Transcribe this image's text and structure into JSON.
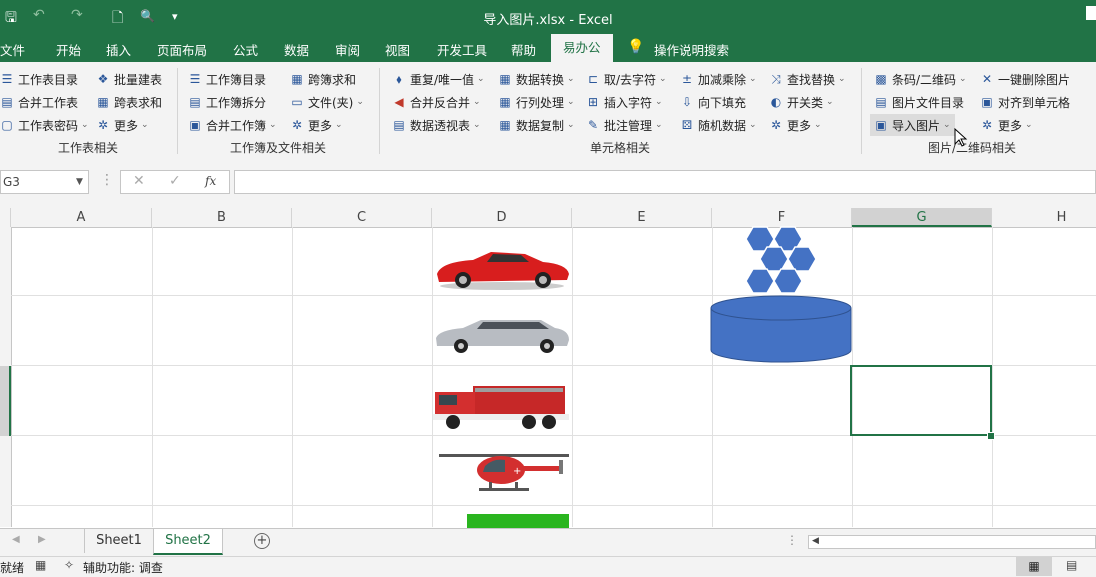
{
  "window": {
    "title": "导入图片.xlsx  -  Excel"
  },
  "quick_access": {
    "save": "🖫",
    "undo": "↶",
    "redo": "↷",
    "new": "🗋",
    "preview": "🔍",
    "more": "▾"
  },
  "menu": {
    "tabs": [
      "文件",
      "开始",
      "插入",
      "页面布局",
      "公式",
      "数据",
      "审阅",
      "视图",
      "开发工具",
      "帮助",
      "易办公"
    ],
    "active": "易办公",
    "search_label": "操作说明搜索"
  },
  "ribbon": {
    "g1": {
      "items": [
        "工作表目录",
        "合并工作表",
        "工作表密码",
        "批量建表",
        "跨表求和",
        "更多"
      ],
      "label": "工作表相关"
    },
    "g2": {
      "items": [
        "工作簿目录",
        "工作簿拆分",
        "合并工作簿",
        "跨簿求和",
        "文件(夹)",
        "更多"
      ],
      "label": "工作簿及文件相关"
    },
    "g3": {
      "items": [
        "重复/唯一值",
        "合并反合并",
        "数据透视表",
        "数据转换",
        "行列处理",
        "数据复制",
        "取/去字符",
        "插入字符",
        "批注管理",
        "加减乘除",
        "向下填充",
        "随机数据",
        "查找替换",
        "开关类",
        "更多"
      ],
      "label": "单元格相关"
    },
    "g4": {
      "items": [
        "条码/二维码",
        "图片文件目录",
        "导入图片",
        "一键删除图片",
        "对齐到单元格",
        "更多"
      ],
      "label": "图片/二维码相关"
    }
  },
  "formula_bar": {
    "name_box": "G3",
    "cancel": "✕",
    "enter": "✓",
    "fx": "fx",
    "value": ""
  },
  "columns": [
    "A",
    "B",
    "C",
    "D",
    "E",
    "F",
    "G",
    "H"
  ],
  "selected_column": "G",
  "sheets": {
    "tabs": [
      "Sheet1",
      "Sheet2"
    ],
    "active": "Sheet2",
    "add": "+"
  },
  "status": {
    "ready": "就绪",
    "accessibility": "辅助功能: 调查"
  },
  "images": [
    "red-sports-car",
    "silver-limousine",
    "fire-truck",
    "helicopter",
    "green-block"
  ]
}
